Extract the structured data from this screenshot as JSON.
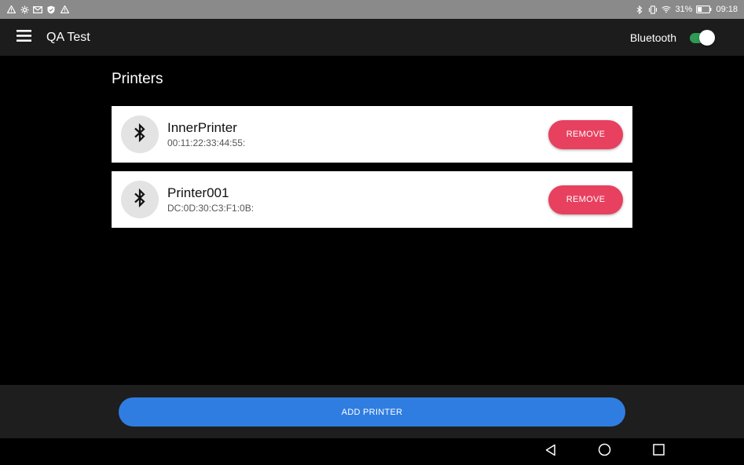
{
  "status_bar": {
    "battery_percent": "31%",
    "time": "09:18",
    "left_icons": [
      "warning-icon",
      "settings-icon",
      "mail-icon",
      "shield-icon",
      "warning-icon"
    ],
    "right_icons": [
      "bluetooth-icon",
      "vibrate-icon",
      "wifi-icon",
      "battery-icon"
    ]
  },
  "app_bar": {
    "title": "QA Test",
    "bluetooth_label": "Bluetooth",
    "bluetooth_enabled": true
  },
  "main": {
    "section_title": "Printers",
    "printers": [
      {
        "name": "InnerPrinter",
        "mac": "00:11:22:33:44:55:",
        "remove_label": "REMOVE"
      },
      {
        "name": "Printer001",
        "mac": "DC:0D:30:C3:F1:0B:",
        "remove_label": "REMOVE"
      }
    ]
  },
  "bottom": {
    "add_printer_label": "ADD PRINTER"
  },
  "colors": {
    "remove_button": "#e8405f",
    "add_button": "#2f7de1",
    "toggle_on": "#2f9a55",
    "app_bar_bg": "#1c1c1c",
    "status_bar_bg": "#8a8a8a"
  }
}
